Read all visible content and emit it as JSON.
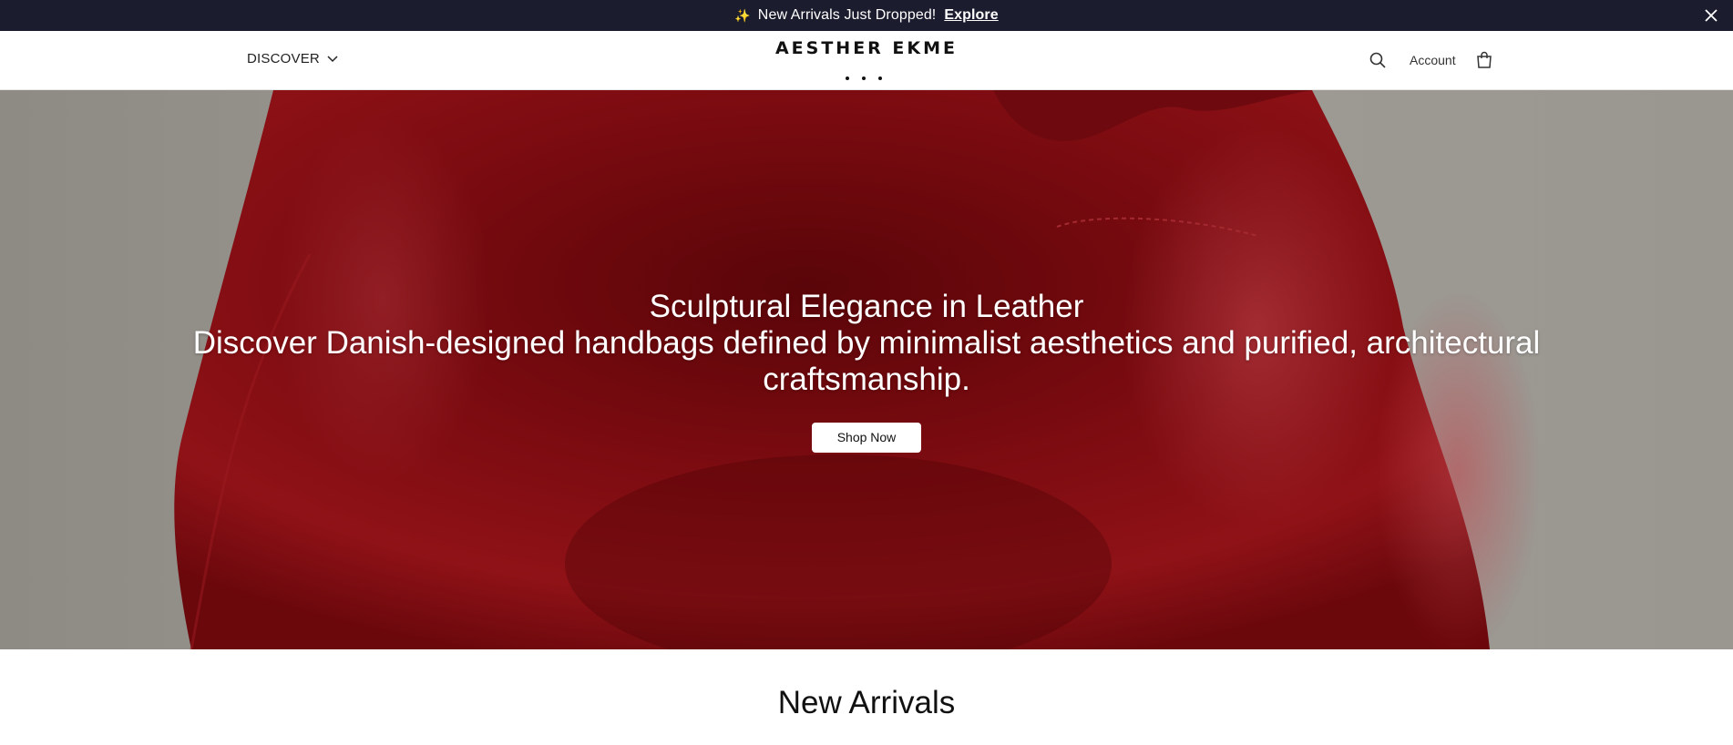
{
  "announcement": {
    "sparkle": "✨",
    "text": "New Arrivals Just Dropped!",
    "link": "Explore",
    "close_icon": "close-icon"
  },
  "header": {
    "discover_label": "DISCOVER",
    "brand": "AESTHER EKME",
    "account_label": "Account",
    "icons": [
      "chevron-down-icon",
      "search-icon",
      "shopping-bag-icon"
    ]
  },
  "hero": {
    "title": "Sculptural Elegance in Leather",
    "subtitle": "Discover Danish-designed handbags defined by minimalist aesthetics and purified, architectural craftsmanship.",
    "button_label": "Shop Now"
  },
  "section": {
    "title": "New Arrivals"
  },
  "colors": {
    "announcement_bg": "#1b1c2e",
    "leather_red": "#8a0f14",
    "backdrop_grey": "#8d8984"
  }
}
